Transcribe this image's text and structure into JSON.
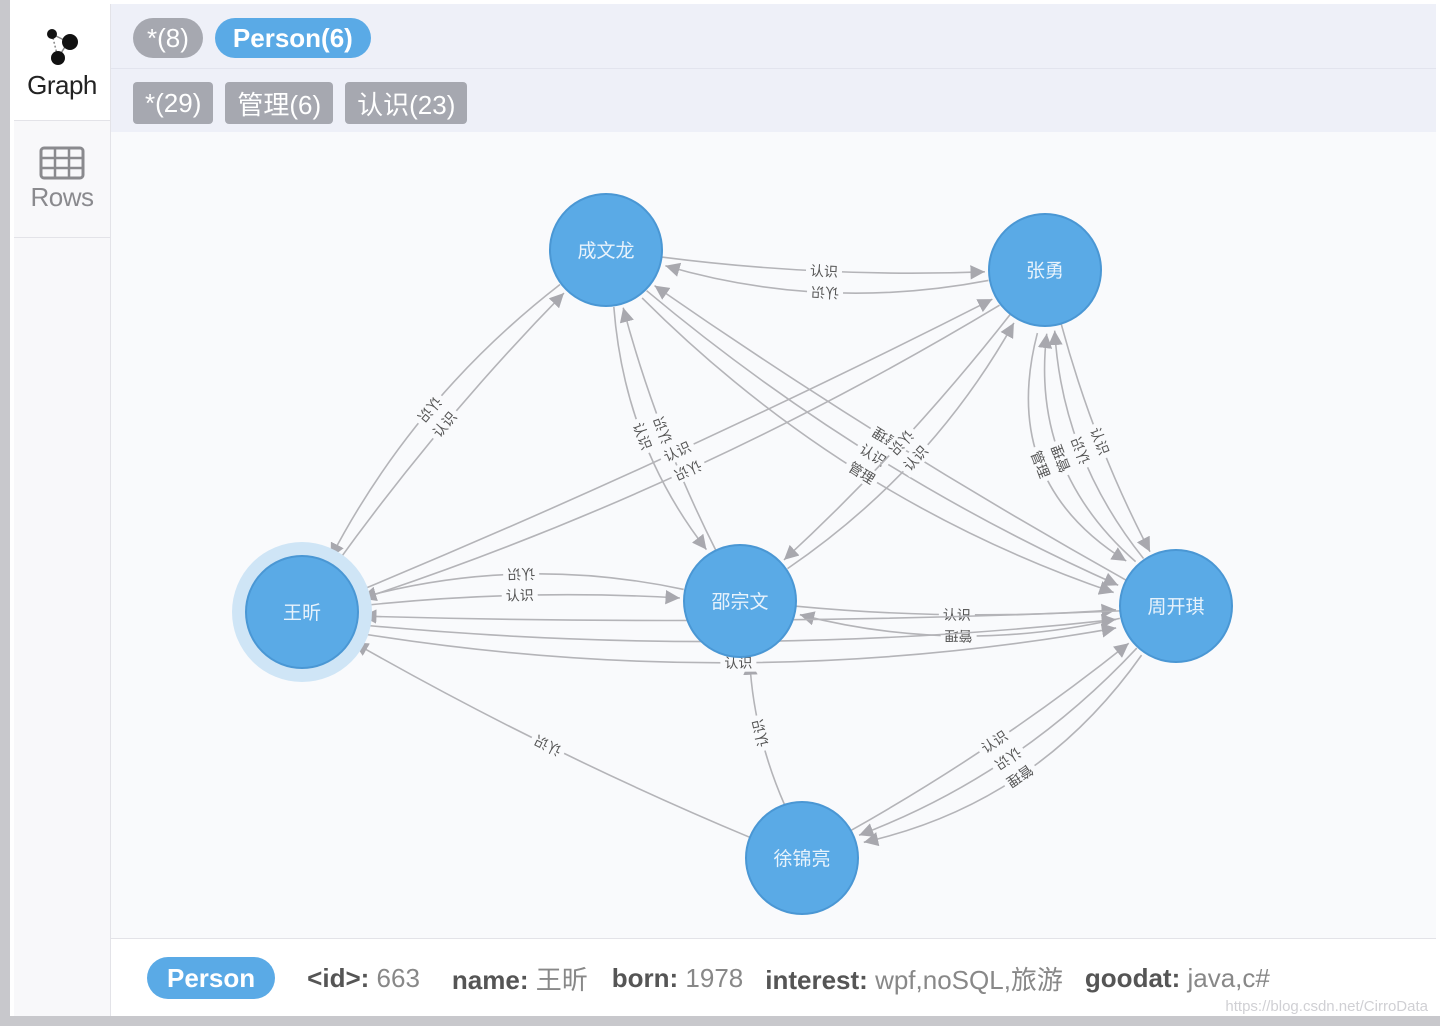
{
  "sidebar": {
    "items": [
      {
        "label": "Graph",
        "icon": "graph-icon",
        "active": true
      },
      {
        "label": "Rows",
        "icon": "table-icon",
        "active": false
      }
    ]
  },
  "header": {
    "node_labels": [
      {
        "label": "*(8)",
        "style": "grey"
      },
      {
        "label": "Person(6)",
        "style": "blue"
      }
    ],
    "relationship_types": [
      {
        "label": "*(29)"
      },
      {
        "label": "管理(6)"
      },
      {
        "label": "认识(23)"
      }
    ]
  },
  "graph": {
    "node_color": "#5aaae6",
    "edge_color": "#b4b4b8",
    "selected_node": "王昕",
    "nodes": [
      {
        "id": "chengwenlong",
        "name": "成文龙"
      },
      {
        "id": "zhangyong",
        "name": "张勇"
      },
      {
        "id": "wangxin",
        "name": "王昕"
      },
      {
        "id": "shaozongwen",
        "name": "邵宗文"
      },
      {
        "id": "zhoukaiqi",
        "name": "周开琪"
      },
      {
        "id": "xujinliang",
        "name": "徐锦亮"
      }
    ],
    "edges": [
      {
        "from": "chengwenlong",
        "to": "zhangyong",
        "type": "认识"
      },
      {
        "from": "zhangyong",
        "to": "chengwenlong",
        "type": "认识"
      },
      {
        "from": "wangxin",
        "to": "chengwenlong",
        "type": "认识"
      },
      {
        "from": "chengwenlong",
        "to": "wangxin",
        "type": "认识"
      },
      {
        "from": "shaozongwen",
        "to": "chengwenlong",
        "type": "认识"
      },
      {
        "from": "chengwenlong",
        "to": "shaozongwen",
        "type": "认识"
      },
      {
        "from": "zhoukaiqi",
        "to": "chengwenlong",
        "type": "管理"
      },
      {
        "from": "chengwenlong",
        "to": "zhoukaiqi",
        "type": "认识"
      },
      {
        "from": "wangxin",
        "to": "zhangyong",
        "type": "认识"
      },
      {
        "from": "zhangyong",
        "to": "wangxin",
        "type": "认识"
      },
      {
        "from": "zhangyong",
        "to": "shaozongwen",
        "type": "认识"
      },
      {
        "from": "zhangyong",
        "to": "zhoukaiqi",
        "type": "认识"
      },
      {
        "from": "zhoukaiqi",
        "to": "zhangyong",
        "type": "认识"
      },
      {
        "from": "zhoukaiqi",
        "to": "zhangyong",
        "type": "管理"
      },
      {
        "from": "wangxin",
        "to": "shaozongwen",
        "type": "认识"
      },
      {
        "from": "shaozongwen",
        "to": "wangxin",
        "type": "认识"
      },
      {
        "from": "shaozongwen",
        "to": "zhoukaiqi",
        "type": "认识"
      },
      {
        "from": "zhoukaiqi",
        "to": "shaozongwen",
        "type": "管理"
      },
      {
        "from": "zhoukaiqi",
        "to": "wangxin",
        "type": "管理"
      },
      {
        "from": "wangxin",
        "to": "zhoukaiqi",
        "type": "认识"
      },
      {
        "from": "xujinliang",
        "to": "wangxin",
        "type": "认识"
      },
      {
        "from": "xujinliang",
        "to": "zhoukaiqi",
        "type": "认识"
      },
      {
        "from": "zhoukaiqi",
        "to": "xujinliang",
        "type": "认识"
      },
      {
        "from": "zhoukaiqi",
        "to": "xujinliang",
        "type": "管理"
      },
      {
        "from": "xujinliang",
        "to": "shaozongwen",
        "type": "认识"
      },
      {
        "from": "zhangyong",
        "to": "zhoukaiqi",
        "type": "管理"
      },
      {
        "from": "shaozongwen",
        "to": "zhangyong",
        "type": "认识"
      },
      {
        "from": "wangxin",
        "to": "zhoukaiqi",
        "type": "认识"
      },
      {
        "from": "chengwenlong",
        "to": "zhoukaiqi",
        "type": "管理"
      }
    ]
  },
  "footer": {
    "label": "Person",
    "properties": [
      {
        "key": "<id>:",
        "value": "663"
      },
      {
        "key": "name:",
        "value": "王昕"
      },
      {
        "key": "born:",
        "value": "1978"
      },
      {
        "key": "interest:",
        "value": "wpf,noSQL,旅游"
      },
      {
        "key": "goodat:",
        "value": "java,c#"
      }
    ],
    "watermark": "https://blog.csdn.net/CirroData"
  }
}
